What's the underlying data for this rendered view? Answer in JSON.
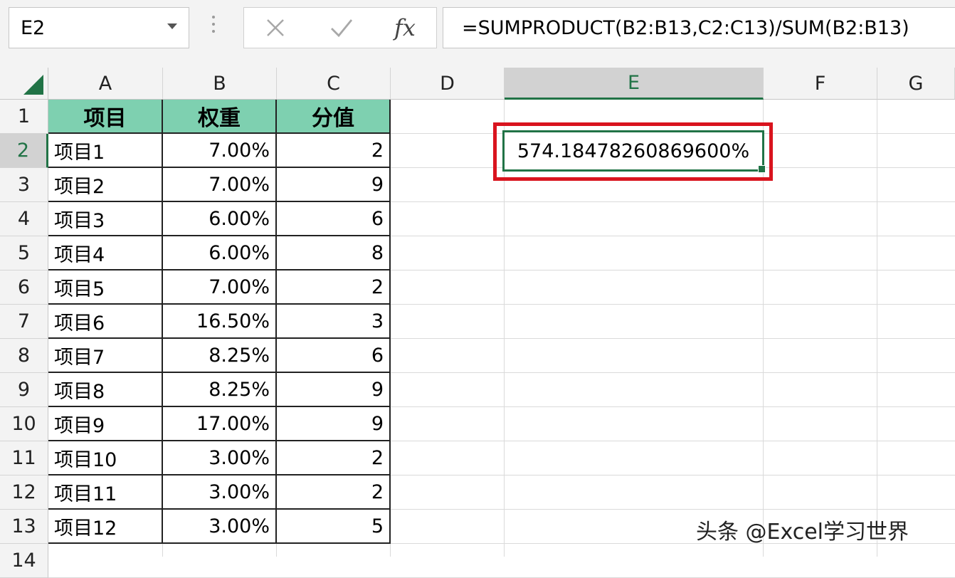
{
  "formula_bar": {
    "name_box": "E2",
    "cancel_icon": "close-icon",
    "enter_icon": "check-icon",
    "fx_label": "fx",
    "formula": "=SUMPRODUCT(B2:B13,C2:C13)/SUM(B2:B13)"
  },
  "grid": {
    "columns": [
      "A",
      "B",
      "C",
      "D",
      "E",
      "F",
      "G"
    ],
    "rows": [
      "1",
      "2",
      "3",
      "4",
      "5",
      "6",
      "7",
      "8",
      "9",
      "10",
      "11",
      "12",
      "13",
      "14"
    ],
    "header": {
      "a": "项目",
      "b": "权重",
      "c": "分值"
    },
    "data": [
      {
        "a": "项目1",
        "b": "7.00%",
        "c": "2"
      },
      {
        "a": "项目2",
        "b": "7.00%",
        "c": "9"
      },
      {
        "a": "项目3",
        "b": "6.00%",
        "c": "6"
      },
      {
        "a": "项目4",
        "b": "6.00%",
        "c": "8"
      },
      {
        "a": "项目5",
        "b": "7.00%",
        "c": "2"
      },
      {
        "a": "项目6",
        "b": "16.50%",
        "c": "3"
      },
      {
        "a": "项目7",
        "b": "8.25%",
        "c": "6"
      },
      {
        "a": "项目8",
        "b": "8.25%",
        "c": "9"
      },
      {
        "a": "项目9",
        "b": "17.00%",
        "c": "9"
      },
      {
        "a": "项目10",
        "b": "3.00%",
        "c": "2"
      },
      {
        "a": "项目11",
        "b": "3.00%",
        "c": "2"
      },
      {
        "a": "项目12",
        "b": "3.00%",
        "c": "5"
      }
    ],
    "active_cell": "E2",
    "active_value": "574.18478260869600%",
    "selected_column": "E",
    "selected_row": "2"
  },
  "watermark": "头条 @Excel学习世界",
  "colors": {
    "header_fill": "#7ed0b0",
    "excel_green": "#217346",
    "highlight_red": "#d9141e"
  }
}
